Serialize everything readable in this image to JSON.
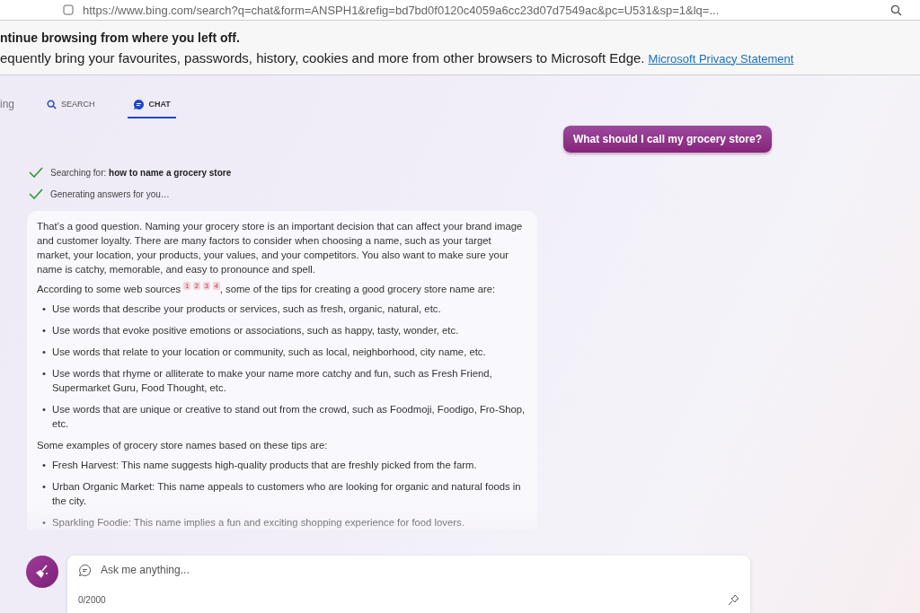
{
  "address_bar": {
    "url": "https://www.bing.com/search?q=chat&form=ANSPH1&refig=bd7bd0f0120c4059a6cc23d07d7549ac&pc=U531&sp=1&lq=..."
  },
  "banner": {
    "title": "ntinue browsing from where you left off.",
    "message": "equently bring your favourites, passwords, history, cookies and more from other browsers to Microsoft Edge.",
    "link": "Microsoft Privacy Statement"
  },
  "tabs": [
    {
      "label": "ing",
      "kind": "plain",
      "selected": false
    },
    {
      "label": "SEARCH",
      "kind": "search",
      "selected": false
    },
    {
      "label": "CHAT",
      "kind": "chat",
      "selected": true
    }
  ],
  "user_message": "What should I call my grocery store?",
  "progress": [
    {
      "label": "Searching for: ",
      "query": "how to name a grocery store"
    },
    {
      "label": "Generating answers for you…"
    }
  ],
  "answer": {
    "intro": "That’s a good question. Naming your grocery store is an important decision that can affect your brand image and customer loyalty. There are many factors to consider when choosing a name, such as your target market, your location, your products, your values, and your competitors. You also want to make sure your name is catchy, memorable, and easy to pronounce and spell.",
    "sources_before": "According to some web sources",
    "citations": [
      "1",
      "2",
      "3",
      "4"
    ],
    "bullet": "•",
    "sources_after": ", some of the tips for creating a good grocery store name are:",
    "tips": [
      "Use words that describe your products or services, such as fresh, organic, natural, etc.",
      "Use words that evoke positive emotions or associations, such as happy, tasty, wonder, etc.",
      "Use words that relate to your location or community, such as local, neighborhood, city name, etc.",
      "Use words that rhyme or alliterate to make your name more catchy and fun, such as Fresh Friend, Supermarket Guru, Food Thought, etc.",
      "Use words that are unique or creative to stand out from the crowd, such as Foodmoji, Foodigo, Fro-Shop, etc."
    ],
    "examples_intro": "Some examples of grocery store names based on these tips are:",
    "examples": [
      "Fresh Harvest: This name suggests high-quality products that are freshly picked from the farm.",
      "Urban Organic Market: This name appeals to customers who are looking for organic and natural foods in the city.",
      "Sparkling Foodie: This name implies a fun and exciting shopping experience for food lovers."
    ]
  },
  "composer": {
    "placeholder": "Ask me anything...",
    "counter": "0/2000"
  }
}
